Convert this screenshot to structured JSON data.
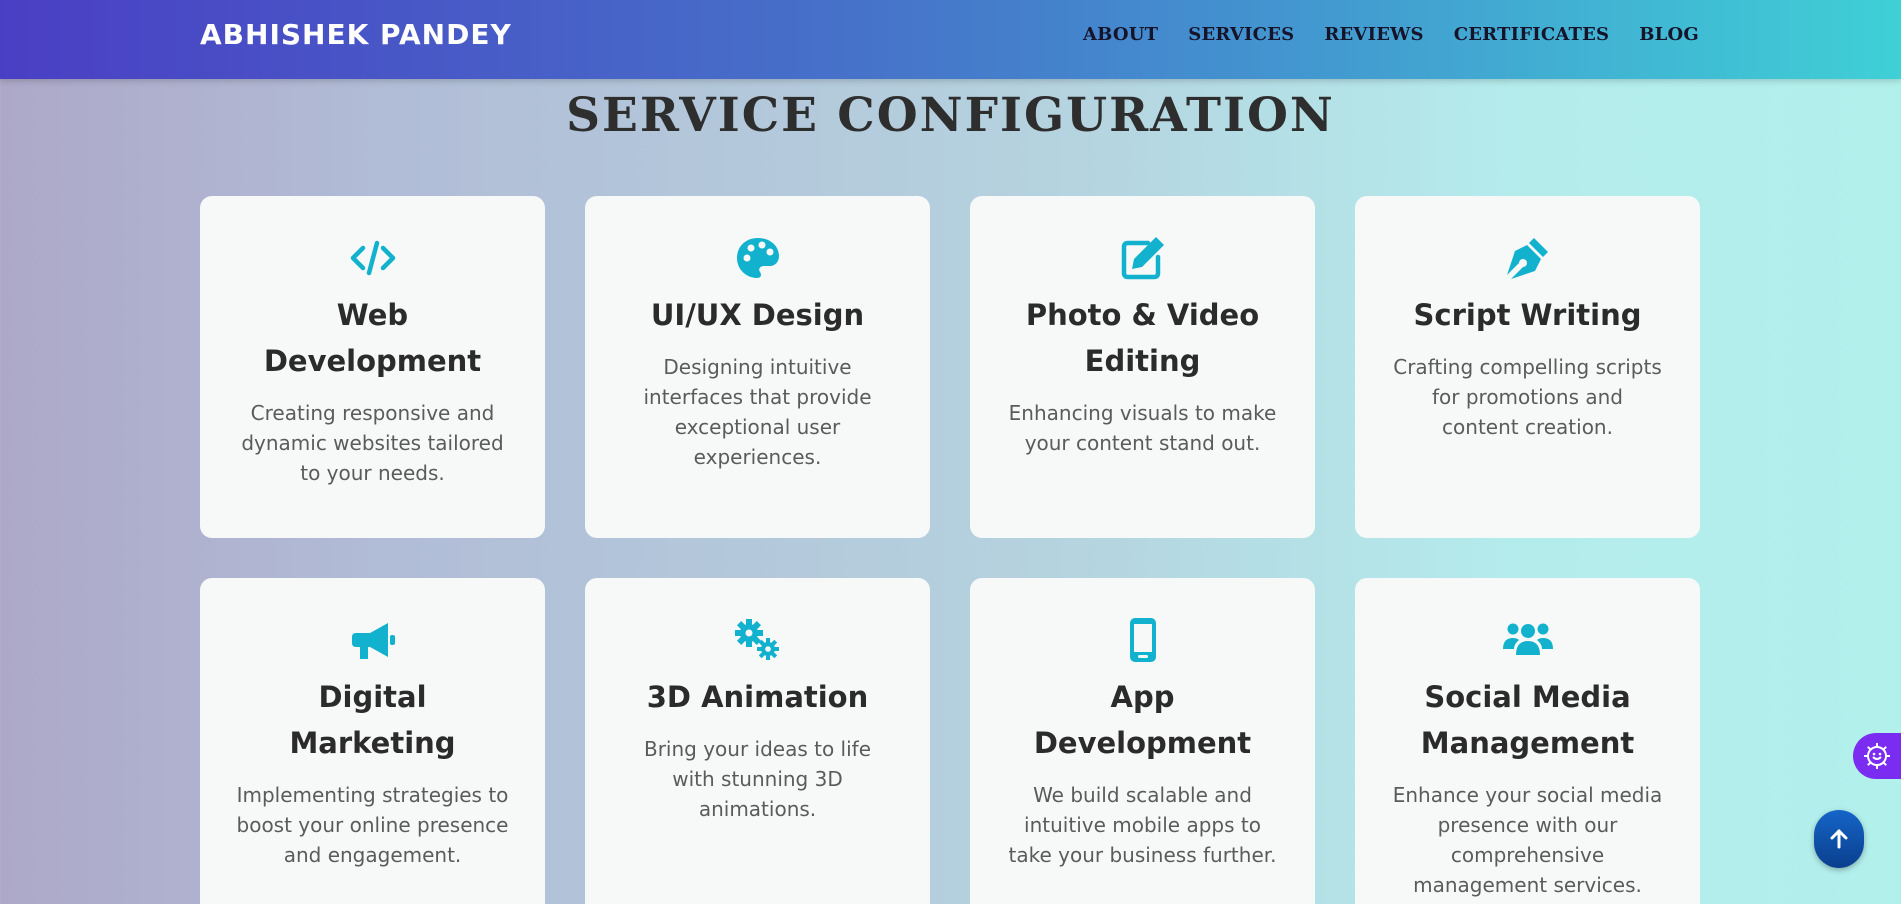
{
  "nav": {
    "logo": "ABHISHEK PANDEY",
    "links": [
      "ABOUT",
      "SERVICES",
      "REVIEWS",
      "CERTIFICATES",
      "BLOG"
    ]
  },
  "section": {
    "title": "SERVICE CONFIGURATION"
  },
  "services": [
    {
      "icon": "code-icon",
      "title": "Web Development",
      "desc": "Creating responsive and dynamic websites tailored to your needs."
    },
    {
      "icon": "palette-icon",
      "title": "UI/UX Design",
      "desc": "Designing intuitive interfaces that provide exceptional user experiences."
    },
    {
      "icon": "edit-icon",
      "title": "Photo & Video Editing",
      "desc": "Enhancing visuals to make your content stand out."
    },
    {
      "icon": "pen-nib-icon",
      "title": "Script Writing",
      "desc": "Crafting compelling scripts for promotions and content creation."
    },
    {
      "icon": "megaphone-icon",
      "title": "Digital Marketing",
      "desc": "Implementing strategies to boost your online presence and engagement."
    },
    {
      "icon": "gears-icon",
      "title": "3D Animation",
      "desc": "Bring your ideas to life with stunning 3D animations."
    },
    {
      "icon": "mobile-icon",
      "title": "App Development",
      "desc": "We build scalable and intuitive mobile apps to take your business further."
    },
    {
      "icon": "users-icon",
      "title": "Social Media Management",
      "desc": "Enhance your social media presence with our comprehensive management services."
    }
  ],
  "colors": {
    "accent": "#12b2ce",
    "nav_start": "#4a3fc4",
    "nav_end": "#3fd0d6",
    "settings": "#7a2df0",
    "scroll_top": "#0d4fa8"
  }
}
